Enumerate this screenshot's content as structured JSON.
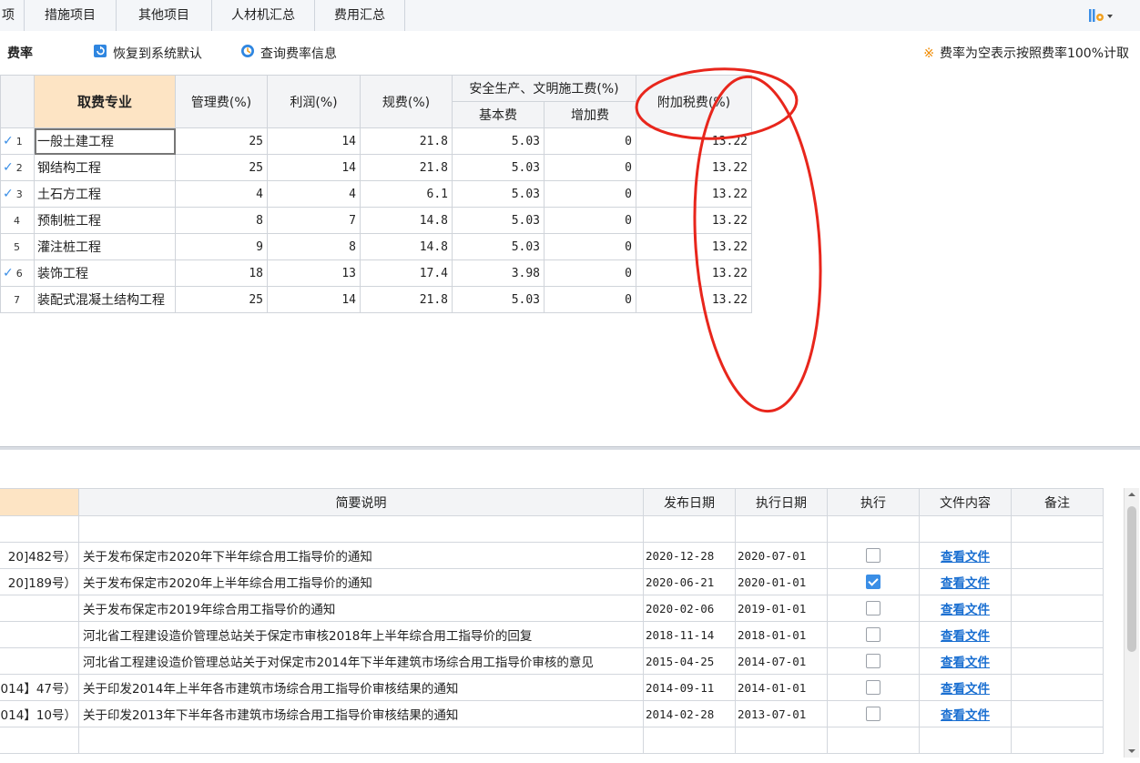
{
  "tabs": [
    {
      "label": "项"
    },
    {
      "label": "措施项目"
    },
    {
      "label": "其他项目"
    },
    {
      "label": "人材机汇总"
    },
    {
      "label": "费用汇总"
    }
  ],
  "toolbar": {
    "title": "费率",
    "restore_label": "恢复到系统默认",
    "query_label": "查询费率信息",
    "note_mark": "※",
    "note": "费率为空表示按照费率100%计取"
  },
  "rate_table": {
    "headers": {
      "specialty": "取费专业",
      "management": "管理费(%)",
      "profit": "利润(%)",
      "regulation": "规费(%)",
      "safety_group": "安全生产、文明施工费(%)",
      "safety_basic": "基本费",
      "safety_extra": "增加费",
      "surtax": "附加税费(%)"
    },
    "rows": [
      {
        "num": "1",
        "checked": true,
        "name": "一般土建工程",
        "management": "25",
        "profit": "14",
        "regulation": "21.8",
        "basic": "5.03",
        "extra": "0",
        "surtax": "13.22"
      },
      {
        "num": "2",
        "checked": true,
        "name": "钢结构工程",
        "management": "25",
        "profit": "14",
        "regulation": "21.8",
        "basic": "5.03",
        "extra": "0",
        "surtax": "13.22"
      },
      {
        "num": "3",
        "checked": true,
        "name": "土石方工程",
        "management": "4",
        "profit": "4",
        "regulation": "6.1",
        "basic": "5.03",
        "extra": "0",
        "surtax": "13.22"
      },
      {
        "num": "4",
        "checked": false,
        "name": "预制桩工程",
        "management": "8",
        "profit": "7",
        "regulation": "14.8",
        "basic": "5.03",
        "extra": "0",
        "surtax": "13.22"
      },
      {
        "num": "5",
        "checked": false,
        "name": "灌注桩工程",
        "management": "9",
        "profit": "8",
        "regulation": "14.8",
        "basic": "5.03",
        "extra": "0",
        "surtax": "13.22"
      },
      {
        "num": "6",
        "checked": true,
        "name": "装饰工程",
        "management": "18",
        "profit": "13",
        "regulation": "17.4",
        "basic": "3.98",
        "extra": "0",
        "surtax": "13.22"
      },
      {
        "num": "7",
        "checked": false,
        "name": "装配式混凝土结构工程",
        "management": "25",
        "profit": "14",
        "regulation": "21.8",
        "basic": "5.03",
        "extra": "0",
        "surtax": "13.22"
      }
    ]
  },
  "doc_table": {
    "headers": {
      "code": "",
      "desc": "简要说明",
      "publish": "发布日期",
      "execute": "执行日期",
      "run": "执行",
      "file": "文件内容",
      "remark": "备注"
    },
    "rows": [
      {
        "code": "",
        "desc": "",
        "publish": "",
        "execute": "",
        "checked": null,
        "file": ""
      },
      {
        "code": "20]482号）",
        "desc": "关于发布保定市2020年下半年综合用工指导价的通知",
        "publish": "2020-12-28",
        "execute": "2020-07-01",
        "checked": false,
        "file": "查看文件"
      },
      {
        "code": "20]189号）",
        "desc": "关于发布保定市2020年上半年综合用工指导价的通知",
        "publish": "2020-06-21",
        "execute": "2020-01-01",
        "checked": true,
        "file": "查看文件"
      },
      {
        "code": "",
        "desc": "关于发布保定市2019年综合用工指导价的通知",
        "publish": "2020-02-06",
        "execute": "2019-01-01",
        "checked": false,
        "file": "查看文件"
      },
      {
        "code": "",
        "desc": "河北省工程建设造价管理总站关于保定市审核2018年上半年综合用工指导价的回复",
        "publish": "2018-11-14",
        "execute": "2018-01-01",
        "checked": false,
        "file": "查看文件"
      },
      {
        "code": "",
        "desc": "河北省工程建设造价管理总站关于对保定市2014年下半年建筑市场综合用工指导价审核的意见",
        "publish": "2015-04-25",
        "execute": "2014-07-01",
        "checked": false,
        "file": "查看文件"
      },
      {
        "code": "014】47号）",
        "desc": "关于印发2014年上半年各市建筑市场综合用工指导价审核结果的通知",
        "publish": "2014-09-11",
        "execute": "2014-01-01",
        "checked": false,
        "file": "查看文件"
      },
      {
        "code": "014】10号）",
        "desc": "关于印发2013年下半年各市建筑市场综合用工指导价审核结果的通知",
        "publish": "2014-02-28",
        "execute": "2013-07-01",
        "checked": false,
        "file": "查看文件"
      },
      {
        "code": "",
        "desc": "",
        "publish": "",
        "execute": "",
        "checked": null,
        "file": ""
      }
    ]
  },
  "colors": {
    "header_highlight": "#fde4c4",
    "accent": "#3a8ee6",
    "link": "#1a6fd1",
    "annotation": "#e8261c"
  }
}
